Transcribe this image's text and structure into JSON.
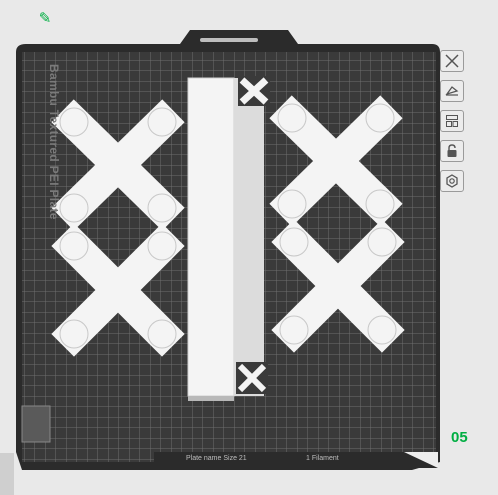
{
  "plate": {
    "name": "Bambu Textured PEI Plate",
    "number": "05",
    "colors": {
      "plate": "#3a3a3a",
      "grid": "#7a7a7a",
      "frame": "#2b2b2b",
      "part": "#f4f4f4",
      "accent": "#00ae42"
    }
  },
  "toolbar": {
    "items": [
      {
        "icon": "close-icon"
      },
      {
        "icon": "auto-orient-icon"
      },
      {
        "icon": "arrange-icon"
      },
      {
        "icon": "lock-icon"
      },
      {
        "icon": "settings-icon"
      }
    ]
  },
  "status_bar": {
    "left_text": "Plate name  Size 21",
    "right_text": "1 Filament"
  }
}
